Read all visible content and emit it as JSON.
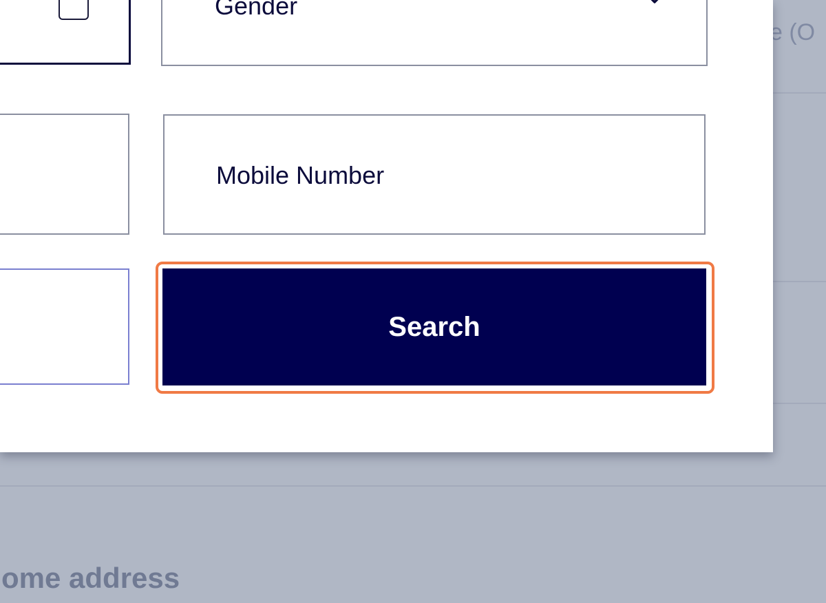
{
  "background": {
    "right_text": "e (O",
    "bottom_text": "ome address"
  },
  "form": {
    "gender_select": {
      "label": "Gender",
      "icon": "chevron-down-icon"
    },
    "mobile_field": {
      "placeholder": "Mobile Number"
    },
    "search_button": {
      "label": "Search"
    }
  },
  "colors": {
    "button_bg": "#000050",
    "highlight": "#f07a45",
    "overlay": "#b0b7c5"
  }
}
